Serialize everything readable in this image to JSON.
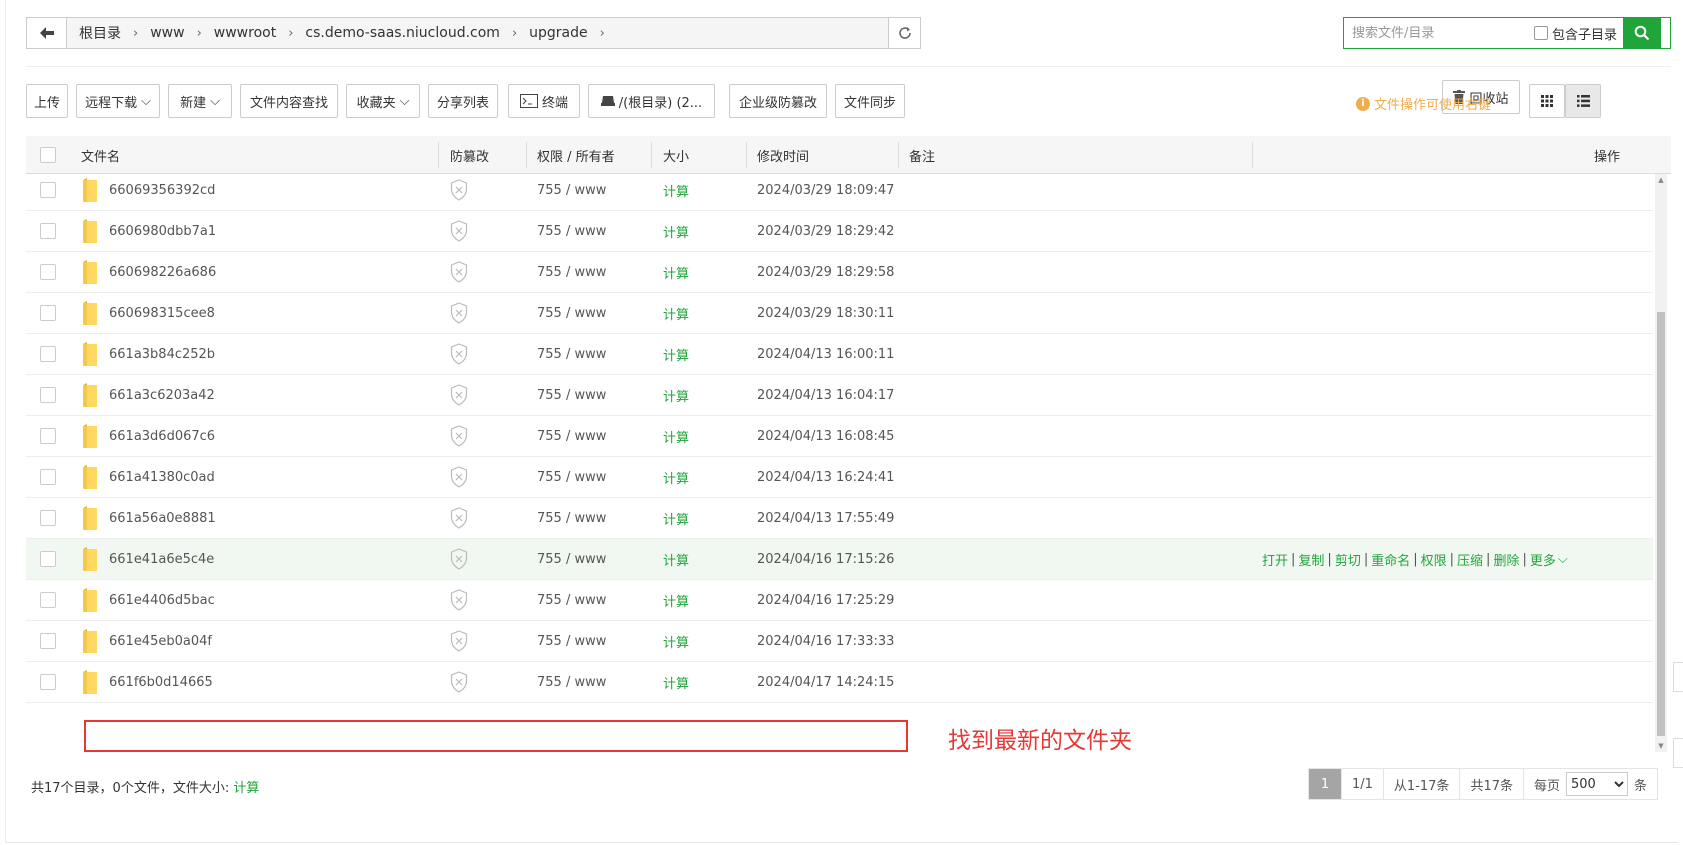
{
  "breadcrumb": [
    "根目录",
    "www",
    "wwwroot",
    "cs.demo-saas.niucloud.com",
    "upgrade"
  ],
  "search": {
    "placeholder": "搜索文件/目录",
    "include_sub_label": "包含子目录"
  },
  "toolbar": {
    "upload": "上传",
    "remote_download": "远程下载",
    "new": "新建",
    "content_search": "文件内容查找",
    "favorites": "收藏夹",
    "share_list": "分享列表",
    "terminal": "终端",
    "disk": "/(根目录) (2...",
    "tamper": "企业级防篡改",
    "sync": "文件同步",
    "tip": "文件操作可使用右键",
    "recycle": "回收站"
  },
  "columns": {
    "name": "文件名",
    "tamper": "防篡改",
    "perm": "权限 / 所有者",
    "size": "大小",
    "mtime": "修改时间",
    "remark": "备注",
    "ops": "操作"
  },
  "rows": [
    {
      "name": "66069356392cd",
      "perm": "755 / www",
      "size": "计算",
      "mtime": "2024/03/29 18:09:47"
    },
    {
      "name": "6606980dbb7a1",
      "perm": "755 / www",
      "size": "计算",
      "mtime": "2024/03/29 18:29:42"
    },
    {
      "name": "660698226a686",
      "perm": "755 / www",
      "size": "计算",
      "mtime": "2024/03/29 18:29:58"
    },
    {
      "name": "660698315cee8",
      "perm": "755 / www",
      "size": "计算",
      "mtime": "2024/03/29 18:30:11"
    },
    {
      "name": "661a3b84c252b",
      "perm": "755 / www",
      "size": "计算",
      "mtime": "2024/04/13 16:00:11"
    },
    {
      "name": "661a3c6203a42",
      "perm": "755 / www",
      "size": "计算",
      "mtime": "2024/04/13 16:04:17"
    },
    {
      "name": "661a3d6d067c6",
      "perm": "755 / www",
      "size": "计算",
      "mtime": "2024/04/13 16:08:45"
    },
    {
      "name": "661a41380c0ad",
      "perm": "755 / www",
      "size": "计算",
      "mtime": "2024/04/13 16:24:41"
    },
    {
      "name": "661a56a0e8881",
      "perm": "755 / www",
      "size": "计算",
      "mtime": "2024/04/13 17:55:49"
    },
    {
      "name": "661e41a6e5c4e",
      "perm": "755 / www",
      "size": "计算",
      "mtime": "2024/04/16 17:15:26"
    },
    {
      "name": "661e4406d5bac",
      "perm": "755 / www",
      "size": "计算",
      "mtime": "2024/04/16 17:25:29"
    },
    {
      "name": "661e45eb0a04f",
      "perm": "755 / www",
      "size": "计算",
      "mtime": "2024/04/16 17:33:33"
    },
    {
      "name": "661f6b0d14665",
      "perm": "755 / www",
      "size": "计算",
      "mtime": "2024/04/17 14:24:15"
    }
  ],
  "row_actions": [
    "打开",
    "复制",
    "剪切",
    "重命名",
    "权限",
    "压缩",
    "删除",
    "更多"
  ],
  "annotation": "找到最新的文件夹",
  "footer": {
    "summary": "共17个目录，0个文件，文件大小:",
    "calc": "计算"
  },
  "pager": {
    "current": "1",
    "pages": "1/1",
    "range": "从1-17条",
    "total": "共17条",
    "per_page_label": "每页",
    "per_page_value": "500",
    "unit": "条"
  },
  "colors": {
    "accent": "#20a53a",
    "warning": "#f0ad4e",
    "annotation": "#e53935",
    "highlight_row": "#f1f8f2"
  },
  "icons": {
    "back": "arrow-left-icon",
    "refresh": "refresh-icon",
    "search": "search-icon",
    "folder": "folder-icon",
    "shield": "shield-x-icon",
    "terminal": "terminal-icon",
    "disk": "disk-icon",
    "trash": "trash-icon",
    "grid": "grid-view-icon",
    "list": "list-view-icon",
    "info": "info-icon"
  }
}
